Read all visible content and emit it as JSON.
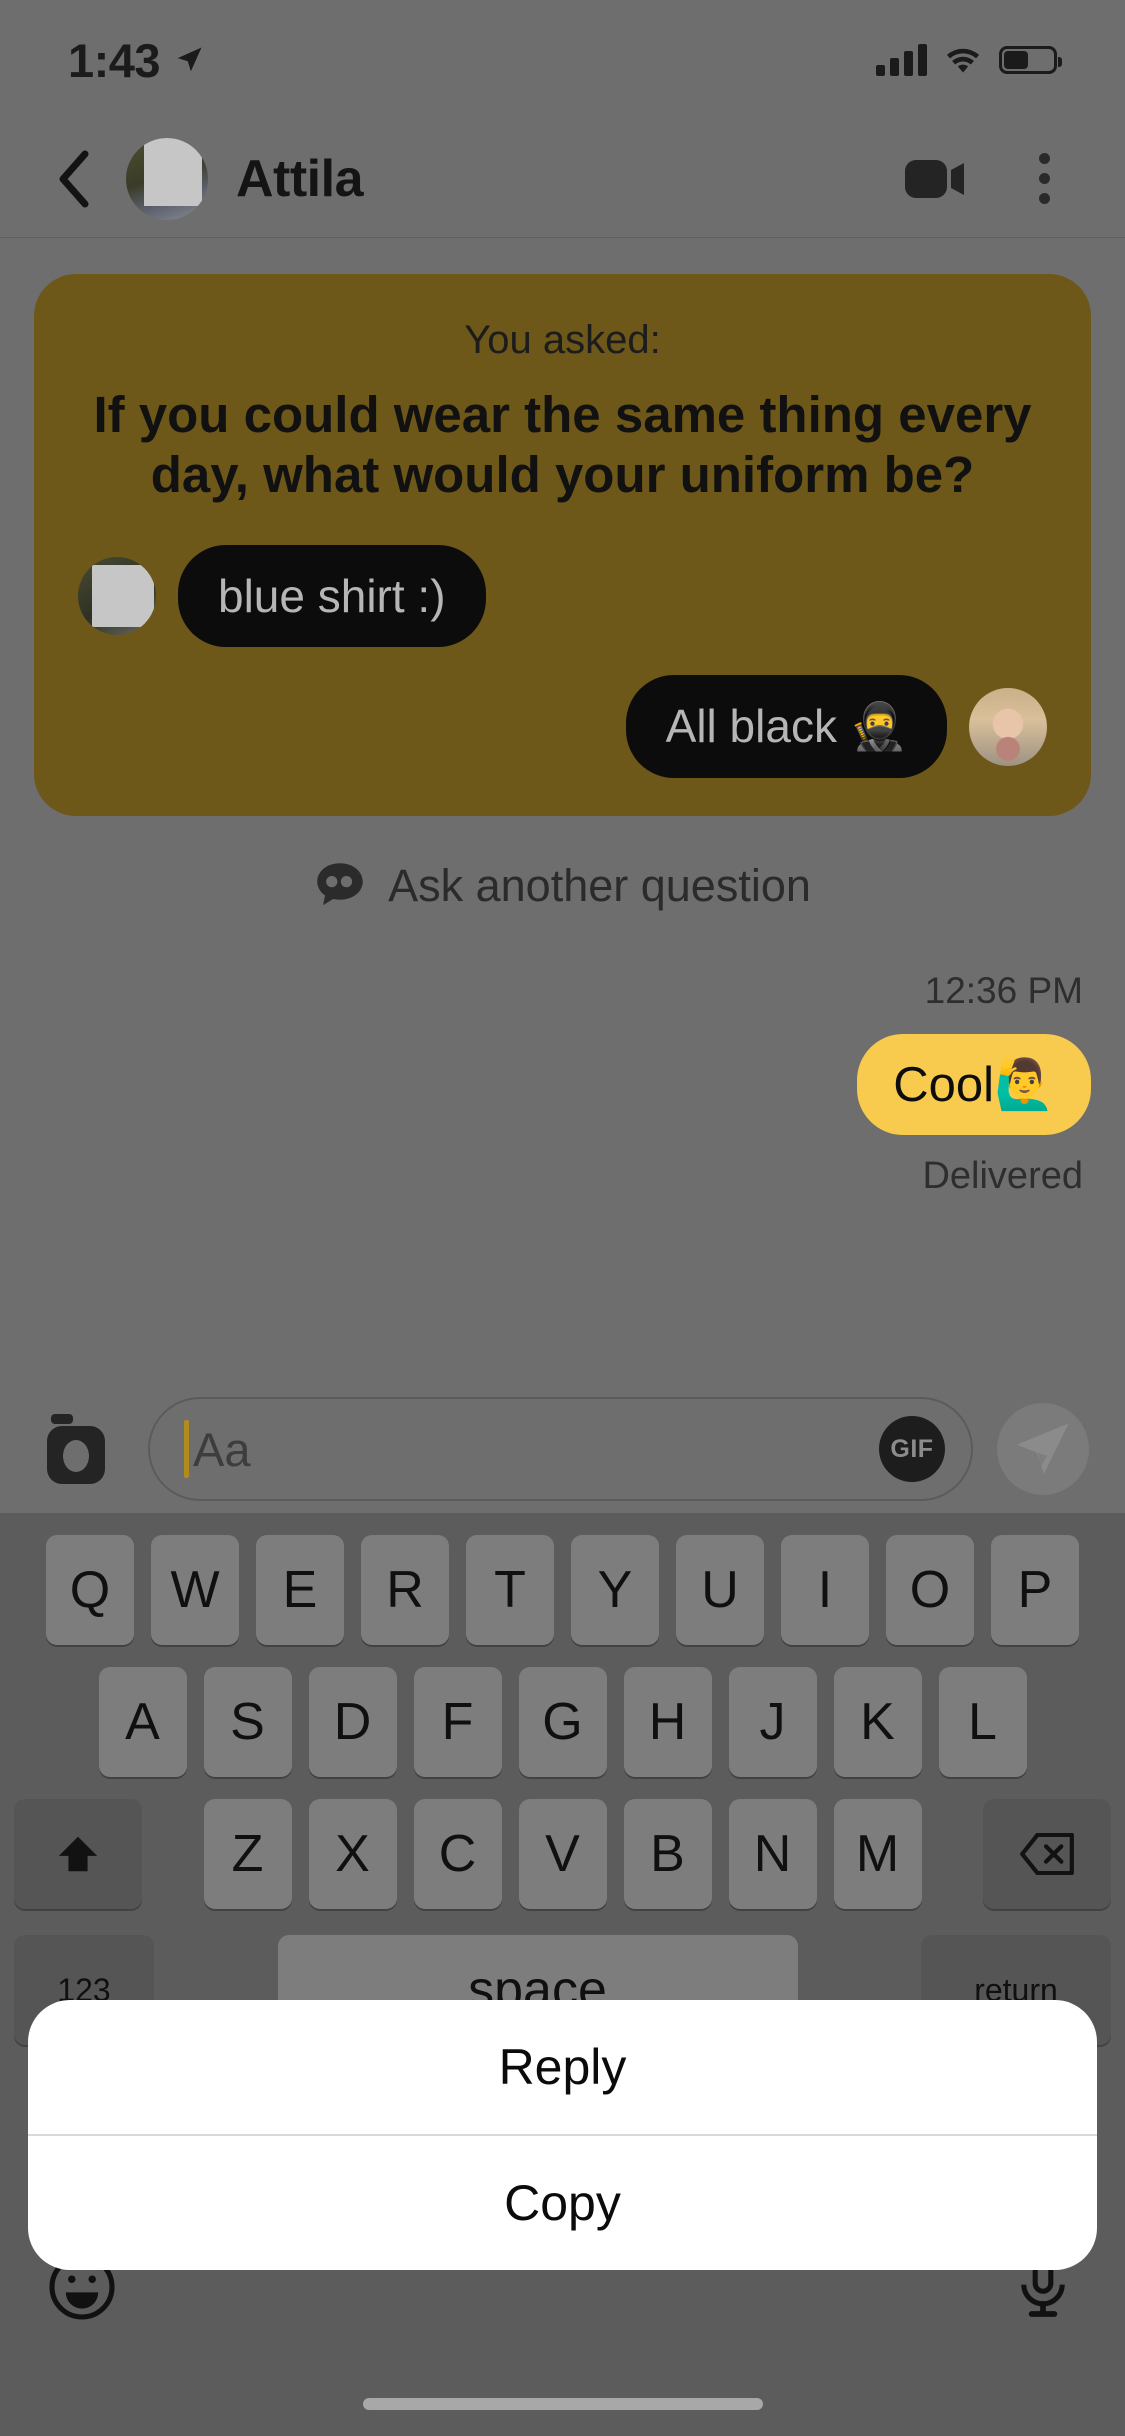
{
  "status_bar": {
    "time": "1:43",
    "location_icon": "location-arrow-icon",
    "signal_icon": "cellular-signal-icon",
    "wifi_icon": "wifi-icon",
    "battery_icon": "battery-icon"
  },
  "nav": {
    "back_icon": "chevron-left-icon",
    "title": "Attila",
    "avatar": "contact-avatar",
    "video_icon": "video-camera-icon",
    "menu_icon": "overflow-menu-icon"
  },
  "question_card": {
    "label": "You asked:",
    "question": "If you could wear the same thing every day, what would your uniform be?",
    "bg_color": "#6d5819",
    "answers": [
      {
        "text": "blue shirt :)",
        "side": "left",
        "avatar": "friend-avatar"
      },
      {
        "text": "All black 🥷",
        "side": "right",
        "avatar": "self-avatar"
      }
    ]
  },
  "ask_another": {
    "icon": "quote-bubble-icon",
    "label": "Ask another question"
  },
  "thread": {
    "timestamp": "12:36 PM",
    "sent_message": "Cool🙋‍♂️",
    "sent_bubble_color": "#f8ca4d",
    "delivery_status": "Delivered"
  },
  "composer": {
    "camera_icon": "camera-icon",
    "placeholder": "Aa",
    "gif_label": "GIF",
    "send_icon": "send-paper-plane-icon"
  },
  "keyboard": {
    "row1": [
      "Q",
      "W",
      "E",
      "R",
      "T",
      "Y",
      "U",
      "I",
      "O",
      "P"
    ],
    "row2": [
      "A",
      "S",
      "D",
      "F",
      "G",
      "H",
      "J",
      "K",
      "L"
    ],
    "row3_shift": "shift-icon",
    "row3": [
      "Z",
      "X",
      "C",
      "V",
      "B",
      "N",
      "M"
    ],
    "row3_backspace": "backspace-icon",
    "row4_numbers": "123",
    "row4_space": "space",
    "row4_return": "return",
    "emoji_icon": "emoji-smiley-icon",
    "mic_icon": "microphone-icon"
  },
  "action_sheet": {
    "items": [
      {
        "label": "Reply"
      },
      {
        "label": "Copy"
      }
    ]
  }
}
